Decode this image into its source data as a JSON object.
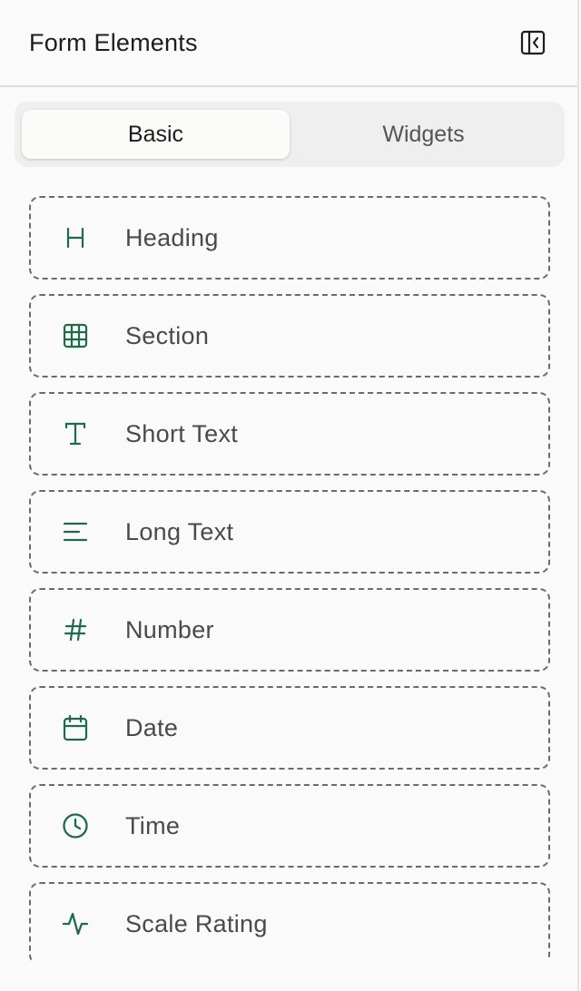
{
  "header": {
    "title": "Form Elements",
    "collapse_icon": "sidebar-collapse-icon"
  },
  "tabs": [
    {
      "label": "Basic",
      "active": true
    },
    {
      "label": "Widgets",
      "active": false
    }
  ],
  "accent_color": "#1e6b4a",
  "items": [
    {
      "label": "Heading",
      "icon": "heading-icon"
    },
    {
      "label": "Section",
      "icon": "grid-icon"
    },
    {
      "label": "Short Text",
      "icon": "text-icon"
    },
    {
      "label": "Long Text",
      "icon": "align-left-icon"
    },
    {
      "label": "Number",
      "icon": "hash-icon"
    },
    {
      "label": "Date",
      "icon": "calendar-icon"
    },
    {
      "label": "Time",
      "icon": "clock-icon"
    },
    {
      "label": "Scale Rating",
      "icon": "activity-icon"
    }
  ]
}
